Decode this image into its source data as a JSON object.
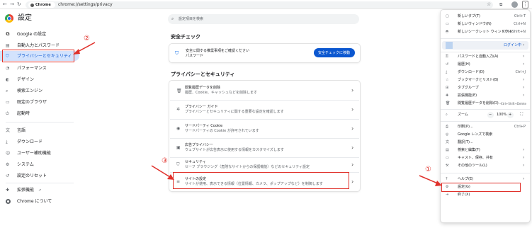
{
  "toolbar": {
    "address_chip": "Chrome",
    "url": "chrome://settings/privacy"
  },
  "header": {
    "title": "設定",
    "search_placeholder": "設定項目を検索"
  },
  "sidebar": {
    "items": [
      {
        "icon": "google-icon",
        "label": "Google の設定"
      },
      {
        "icon": "autofill-icon",
        "label": "自動入力とパスワード"
      },
      {
        "icon": "shield-icon",
        "label": "プライバシーとセキュリティ"
      },
      {
        "icon": "speedometer-icon",
        "label": "パフォーマンス"
      },
      {
        "icon": "palette-icon",
        "label": "デザイン"
      },
      {
        "icon": "search-icon",
        "label": "検索エンジン"
      },
      {
        "icon": "browser-icon",
        "label": "既定のブラウザ"
      },
      {
        "icon": "power-icon",
        "label": "起動時"
      },
      {
        "icon": "language-icon",
        "label": "言語"
      },
      {
        "icon": "download-icon",
        "label": "ダウンロード"
      },
      {
        "icon": "accessibility-icon",
        "label": "ユーザー補助機能"
      },
      {
        "icon": "wrench-icon",
        "label": "システム"
      },
      {
        "icon": "reset-icon",
        "label": "設定のリセット"
      },
      {
        "icon": "puzzle-icon",
        "label": "拡張機能"
      },
      {
        "icon": "chrome-icon",
        "label": "Chrome について"
      }
    ]
  },
  "safety": {
    "heading": "安全チェック",
    "text_line1": "安全に関する推奨事項をご確認ください",
    "text_line2": "パスワード",
    "button": "安全チェックに移動"
  },
  "privacy": {
    "heading": "プライバシーとセキュリティ",
    "rows": [
      {
        "icon": "trash-icon",
        "title": "閲覧履歴データを削除",
        "sub": "履歴、Cookie、キャッシュなどを削除します"
      },
      {
        "icon": "guide-icon",
        "title": "プライバシー ガイド",
        "sub": "プライバシーとセキュリティに関する重要な設定を確認します"
      },
      {
        "icon": "cookie-icon",
        "title": "サードパーティ Cookie",
        "sub": "サードパーティの Cookie が許可されています"
      },
      {
        "icon": "ad-icon",
        "title": "広告プライバシー",
        "sub": "ウェブサイトが広告表示に使用する情報をカスタマイズします"
      },
      {
        "icon": "lock-icon",
        "title": "セキュリティ",
        "sub": "セーフ ブラウジング（危険なサイトからの保護機能）などのセキュリティ設定"
      },
      {
        "icon": "sliders-icon",
        "title": "サイトの設定",
        "sub": "サイトが使用、表示できる情報（位置情報、カメラ、ポップアップなど）を制御します"
      }
    ]
  },
  "menu": {
    "items": [
      {
        "label": "新しいタブ(T)",
        "shortcut": "Ctrl+T",
        "arrow": false
      },
      {
        "label": "新しいウィンドウ(N)",
        "shortcut": "Ctrl+N",
        "arrow": false
      },
      {
        "label": "新しいシークレット ウィンドウ(I)",
        "shortcut": "Ctrl+Shift+N",
        "arrow": false
      },
      {
        "label": "パスワードと自動入力(A)",
        "shortcut": "",
        "arrow": true
      },
      {
        "label": "履歴(H)",
        "shortcut": "",
        "arrow": true
      },
      {
        "label": "ダウンロード(D)",
        "shortcut": "Ctrl+J",
        "arrow": false
      },
      {
        "label": "ブックマークとリスト(B)",
        "shortcut": "",
        "arrow": true
      },
      {
        "label": "タブグループ",
        "shortcut": "",
        "arrow": true
      },
      {
        "label": "拡張機能(E)",
        "shortcut": "",
        "arrow": true
      },
      {
        "label": "閲覧履歴データを削除(D)...",
        "shortcut": "Ctrl+Shift+Delete",
        "arrow": false
      },
      {
        "label": "印刷(P)...",
        "shortcut": "Ctrl+P",
        "arrow": false
      },
      {
        "label": "Google レンズで検索",
        "shortcut": "",
        "arrow": false
      },
      {
        "label": "翻訳(T)...",
        "shortcut": "",
        "arrow": false
      },
      {
        "label": "検索と編集(F)",
        "shortcut": "",
        "arrow": true
      },
      {
        "label": "キャスト、保存、共有",
        "shortcut": "",
        "arrow": true
      },
      {
        "label": "その他のツール(L)",
        "shortcut": "",
        "arrow": true
      },
      {
        "label": "ヘルプ(E)",
        "shortcut": "",
        "arrow": true
      },
      {
        "label": "設定(G)",
        "shortcut": "",
        "arrow": false
      },
      {
        "label": "終了(X)",
        "shortcut": "",
        "arrow": false
      }
    ],
    "profile_status": "ログイン中",
    "zoom_label": "ズーム",
    "zoom_minus": "−",
    "zoom_value": "100%",
    "zoom_plus": "+"
  },
  "annotations": {
    "one": "①",
    "two": "②",
    "three": "③"
  },
  "colors": {
    "accent": "#1a73e8",
    "annotation_red": "#e0302a"
  }
}
